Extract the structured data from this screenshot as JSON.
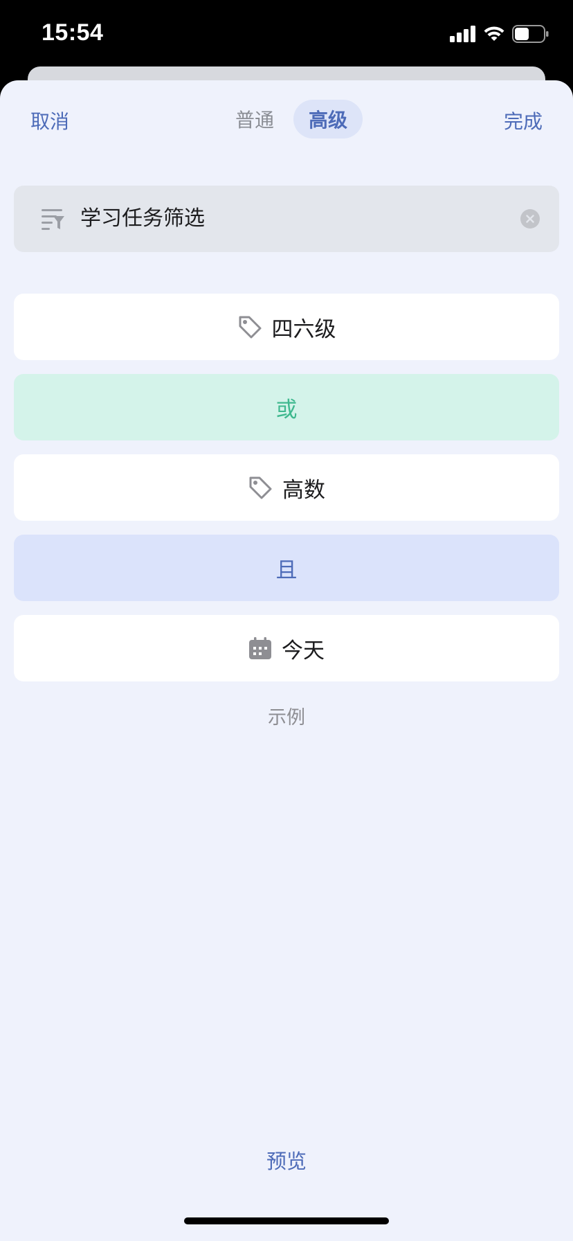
{
  "status_bar": {
    "time": "15:54"
  },
  "nav": {
    "cancel": "取消",
    "done": "完成",
    "tabs": [
      {
        "label": "普通",
        "active": false
      },
      {
        "label": "高级",
        "active": true
      }
    ]
  },
  "filter_name": {
    "value": "学习任务筛选",
    "icon": "filter-icon"
  },
  "conditions": [
    {
      "type": "tag",
      "label": "四六级",
      "icon": "tag-icon"
    },
    {
      "type": "operator",
      "label": "或"
    },
    {
      "type": "tag",
      "label": "高数",
      "icon": "tag-icon"
    },
    {
      "type": "operator",
      "label": "且"
    },
    {
      "type": "date",
      "label": "今天",
      "icon": "calendar-icon"
    }
  ],
  "example_label": "示例",
  "preview_label": "预览",
  "colors": {
    "accent": "#4d6bb8",
    "or_text": "#3fb88f",
    "or_bg": "#d4f3ea",
    "and_bg": "#dbe3fb",
    "sheet_bg": "#eff2fc"
  }
}
